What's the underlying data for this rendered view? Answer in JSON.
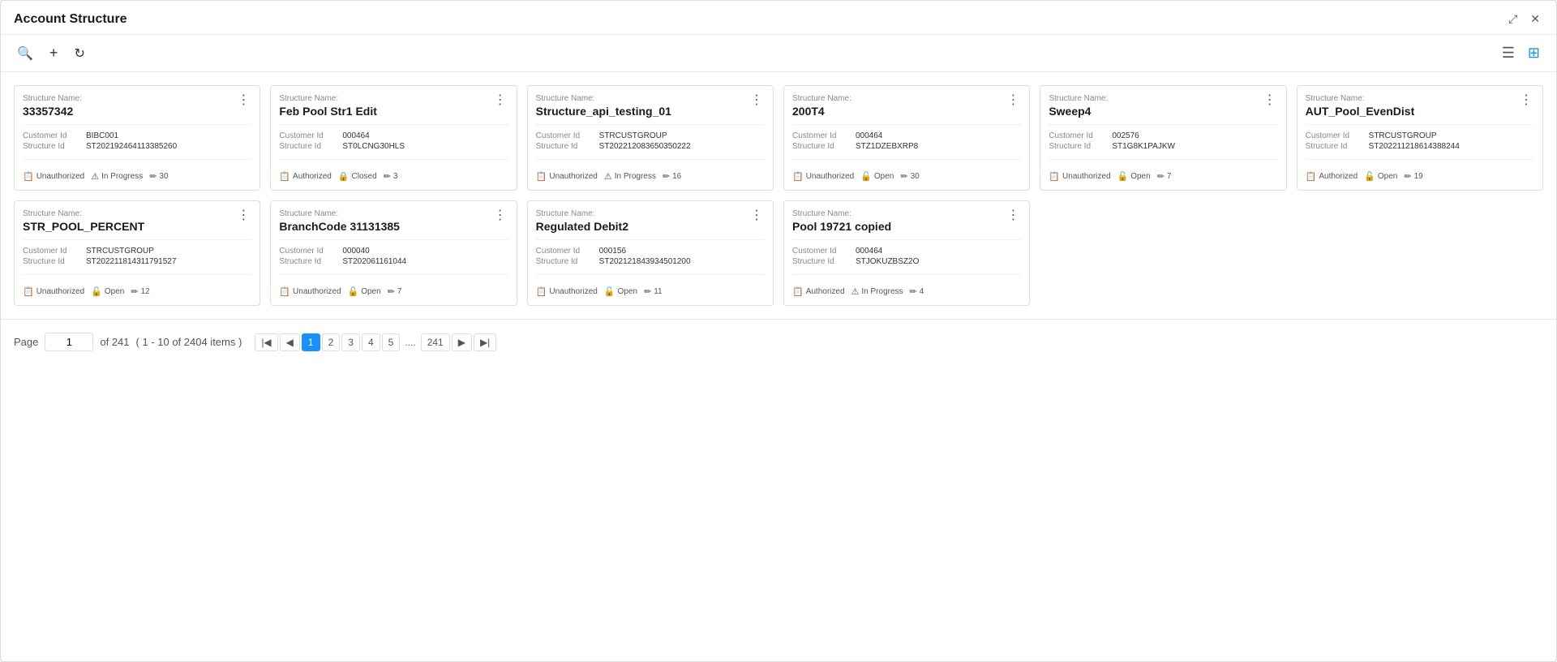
{
  "window": {
    "title": "Account Structure",
    "resize_icon": "⤢",
    "close_icon": "✕"
  },
  "toolbar": {
    "search_icon": "🔍",
    "add_icon": "+",
    "refresh_icon": "↻",
    "list_view_icon": "≡",
    "grid_view_icon": "⊞"
  },
  "cards": [
    {
      "structure_name_label": "Structure Name:",
      "structure_name": "33357342",
      "customer_id_label": "Customer Id",
      "customer_id": "BIBC001",
      "structure_id_label": "Structure Id",
      "structure_id": "ST202192464113385260",
      "auth_status": "Unauthorized",
      "lock_status": "In Progress",
      "count": "30"
    },
    {
      "structure_name_label": "Structure Name:",
      "structure_name": "Feb Pool Str1 Edit",
      "customer_id_label": "Customer Id",
      "customer_id": "000464",
      "structure_id_label": "Structure Id",
      "structure_id": "ST0LCNG30HLS",
      "auth_status": "Authorized",
      "lock_status": "Closed",
      "count": "3"
    },
    {
      "structure_name_label": "Structure Name:",
      "structure_name": "Structure_api_testing_01",
      "customer_id_label": "Customer Id",
      "customer_id": "STRCUSTGROUP",
      "structure_id_label": "Structure Id",
      "structure_id": "ST202212083650350222",
      "auth_status": "Unauthorized",
      "lock_status": "In Progress",
      "count": "16"
    },
    {
      "structure_name_label": "Structure Name:",
      "structure_name": "200T4",
      "customer_id_label": "Customer Id",
      "customer_id": "000464",
      "structure_id_label": "Structure Id",
      "structure_id": "STZ1DZEBXRP8",
      "auth_status": "Unauthorized",
      "lock_status": "Open",
      "count": "30"
    },
    {
      "structure_name_label": "Structure Name:",
      "structure_name": "Sweep4",
      "customer_id_label": "Customer Id",
      "customer_id": "002576",
      "structure_id_label": "Structure Id",
      "structure_id": "ST1G8K1PAJKW",
      "auth_status": "Unauthorized",
      "lock_status": "Open",
      "count": "7"
    },
    {
      "structure_name_label": "Structure Name:",
      "structure_name": "AUT_Pool_EvenDist",
      "customer_id_label": "Customer Id",
      "customer_id": "STRCUSTGROUP",
      "structure_id_label": "Structure Id",
      "structure_id": "ST202211218614388244",
      "auth_status": "Authorized",
      "lock_status": "Open",
      "count": "19"
    },
    {
      "structure_name_label": "Structure Name:",
      "structure_name": "STR_POOL_PERCENT",
      "customer_id_label": "Customer Id",
      "customer_id": "STRCUSTGROUP",
      "structure_id_label": "Structure Id",
      "structure_id": "ST202211814311791527",
      "auth_status": "Unauthorized",
      "lock_status": "Open",
      "count": "12"
    },
    {
      "structure_name_label": "Structure Name:",
      "structure_name": "BranchCode 31131385",
      "customer_id_label": "Customer Id",
      "customer_id": "000040",
      "structure_id_label": "Structure Id",
      "structure_id": "ST202061161044",
      "auth_status": "Unauthorized",
      "lock_status": "Open",
      "count": "7"
    },
    {
      "structure_name_label": "Structure Name:",
      "structure_name": "Regulated Debit2",
      "customer_id_label": "Customer Id",
      "customer_id": "000156",
      "structure_id_label": "Structure Id",
      "structure_id": "ST202121843934501200",
      "auth_status": "Unauthorized",
      "lock_status": "Open",
      "count": "11"
    },
    {
      "structure_name_label": "Structure Name:",
      "structure_name": "Pool 19721 copied",
      "customer_id_label": "Customer Id",
      "customer_id": "000464",
      "structure_id_label": "Structure Id",
      "structure_id": "STJOKUZBSZ2O",
      "auth_status": "Authorized",
      "lock_status": "In Progress",
      "count": "4"
    }
  ],
  "pagination": {
    "page_label": "Page",
    "page_value": "1",
    "of_label": "of 241",
    "items_info": "( 1 - 10 of 2404 items )",
    "pages": [
      "1",
      "2",
      "3",
      "4",
      "5",
      "241"
    ],
    "ellipsis": "....",
    "first_icon": "|◀",
    "prev_icon": "◀",
    "next_icon": "▶",
    "last_icon": "▶|"
  }
}
